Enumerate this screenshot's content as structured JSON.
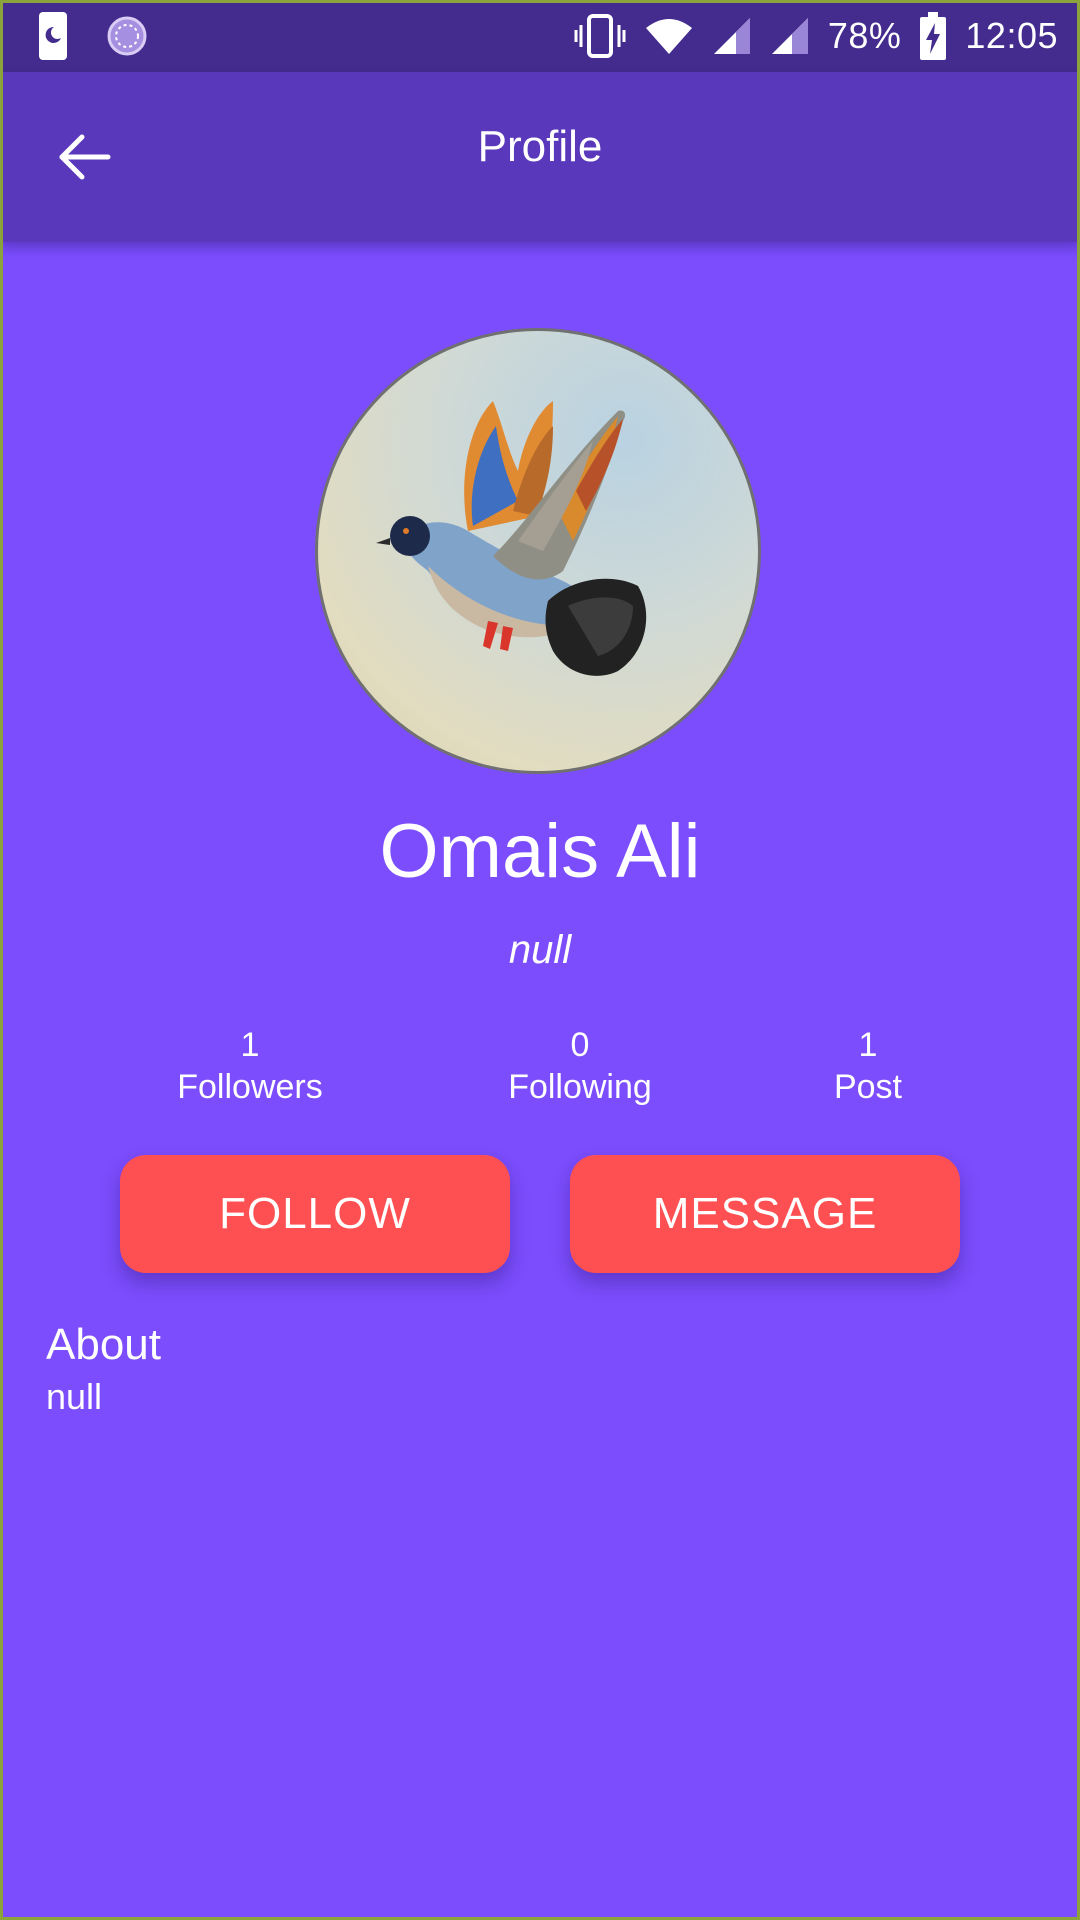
{
  "status_bar": {
    "battery": "78%",
    "time": "12:05"
  },
  "app_bar": {
    "title": "Profile"
  },
  "profile": {
    "name": "Omais Ali",
    "status": "null",
    "avatar_icon": "pigeon-photo"
  },
  "stats": {
    "followers": {
      "value": "1",
      "label": "Followers"
    },
    "following": {
      "value": "0",
      "label": "Following"
    },
    "posts": {
      "value": "1",
      "label": "Post"
    }
  },
  "actions": {
    "follow_label": "FOLLOW",
    "message_label": "MESSAGE"
  },
  "about": {
    "title": "About",
    "text": "null"
  },
  "colors": {
    "background": "#7b4dfc",
    "app_bar": "#5a38bb",
    "status_bar": "#432c8e",
    "button": "#fe5052"
  }
}
